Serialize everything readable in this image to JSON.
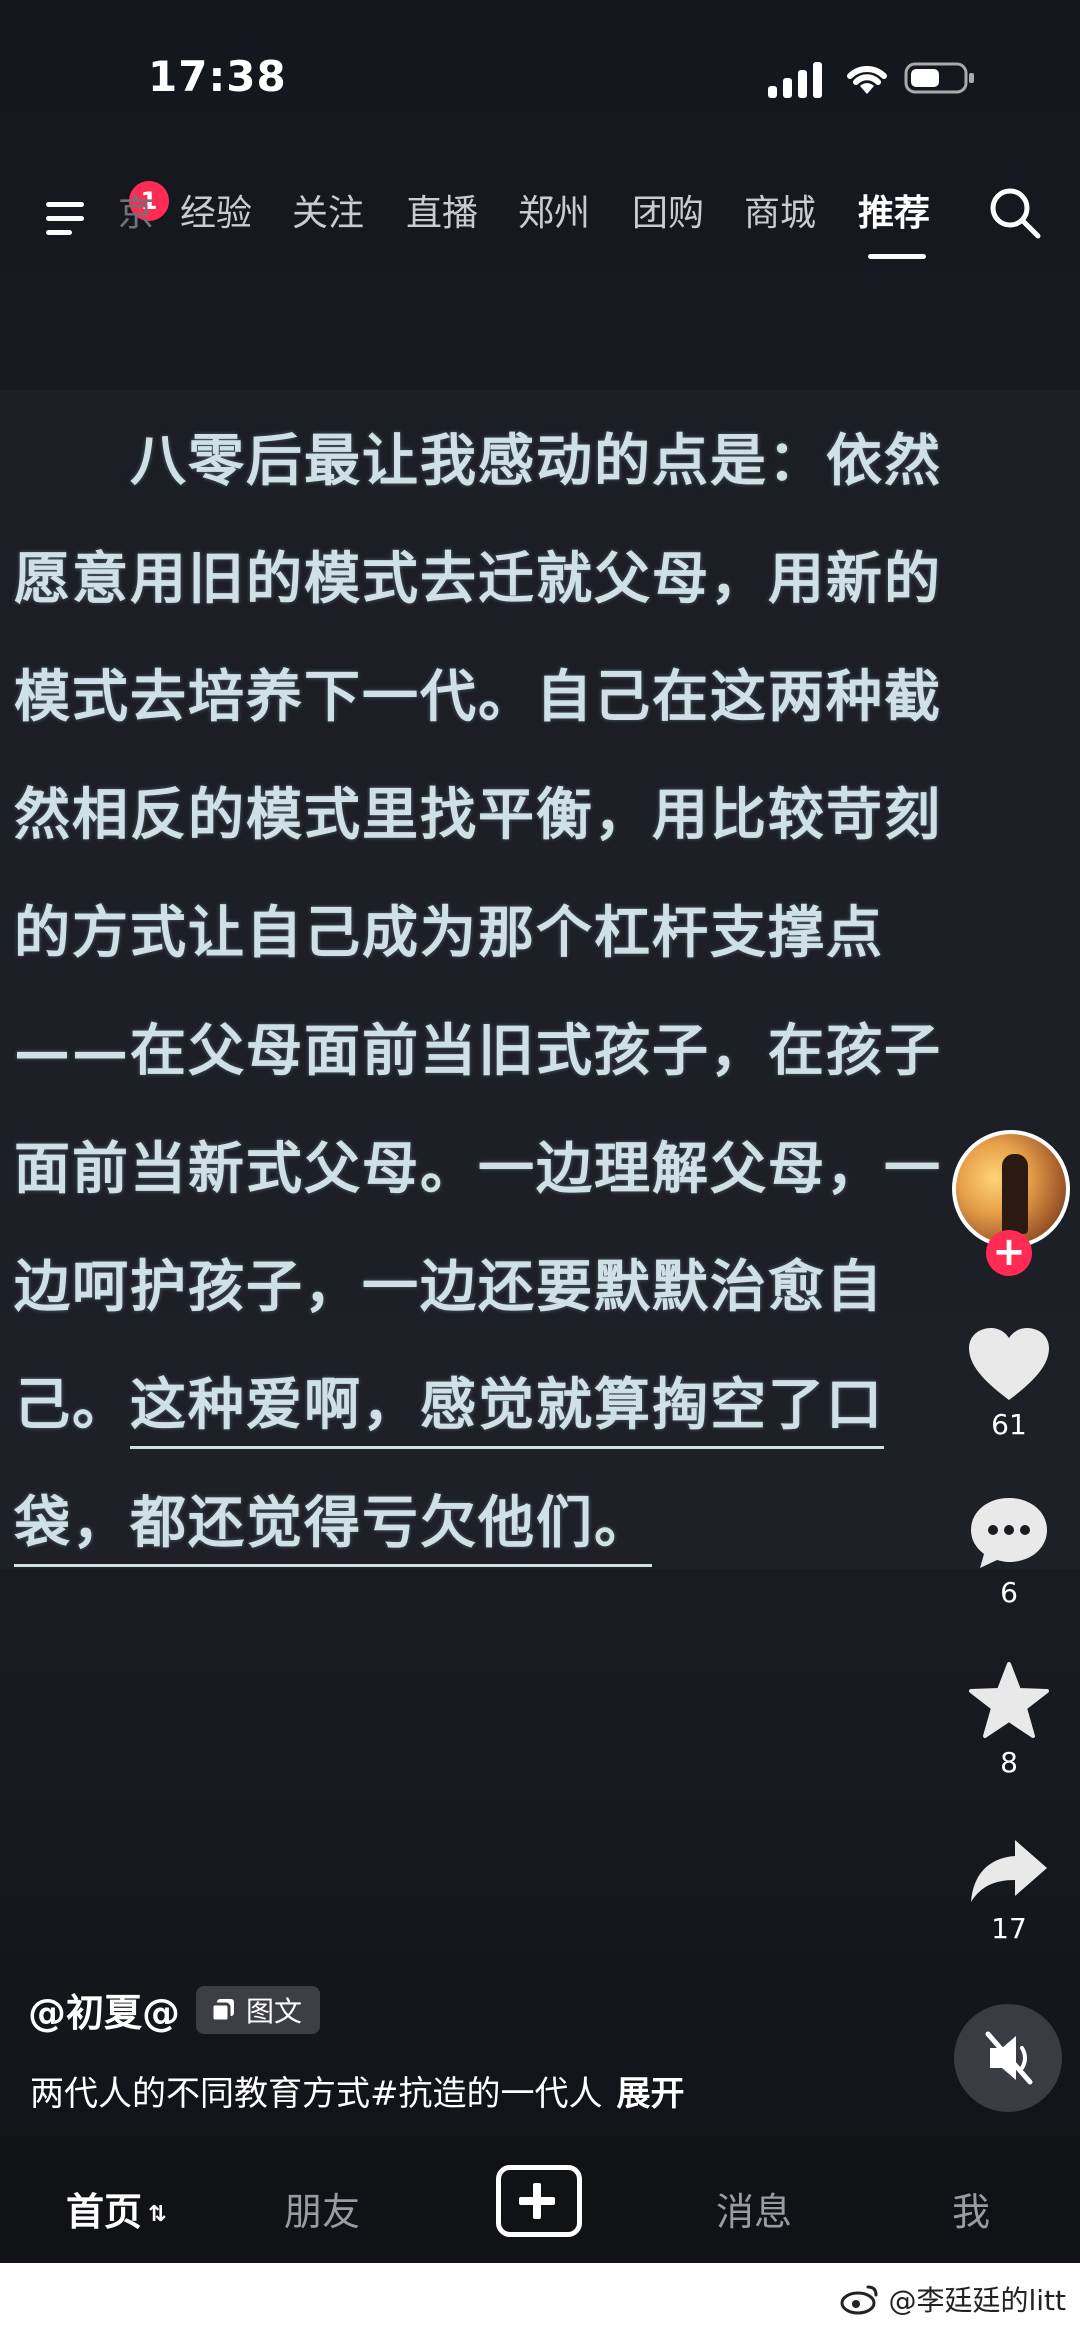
{
  "status": {
    "time": "17:38"
  },
  "topnav": {
    "badge": "1",
    "tabs": [
      {
        "label": "京",
        "active": false
      },
      {
        "label": "经验",
        "active": false
      },
      {
        "label": "关注",
        "active": false
      },
      {
        "label": "直播",
        "active": false
      },
      {
        "label": "郑州",
        "active": false
      },
      {
        "label": "团购",
        "active": false
      },
      {
        "label": "商城",
        "active": false
      },
      {
        "label": "推荐",
        "active": true
      }
    ]
  },
  "content": {
    "lines": [
      "　　八零后最让我感动的点是：依然",
      "愿意用旧的模式去迁就父母，用新的",
      "模式去培养下一代。自己在这两种截",
      "然相反的模式里找平衡，用比较苛刻",
      "的方式让自己成为那个杠杆支撑点",
      "——在父母面前当旧式孩子，在孩子",
      "面前当新式父母。一边理解父母，一",
      "边呵护孩子，一边还要默默治愈自"
    ],
    "line9_plain": "己。",
    "line9_underlined": "这种爱啊，感觉就算掏空了口",
    "line10_underlined": "袋，都还觉得亏欠他们。"
  },
  "actions": {
    "likes": "61",
    "comments": "6",
    "favorites": "8",
    "shares": "17"
  },
  "post": {
    "author": "@初夏@",
    "type_tag": "图文",
    "description": "两代人的不同教育方式#抗造的一代人",
    "expand": "展开"
  },
  "bottomnav": {
    "home": "首页",
    "friends": "朋友",
    "messages": "消息",
    "me": "我"
  },
  "watermark": "@李廷廷的litt",
  "colors": {
    "accent": "#ff2b54",
    "text_glow": "#cfe0e6"
  }
}
